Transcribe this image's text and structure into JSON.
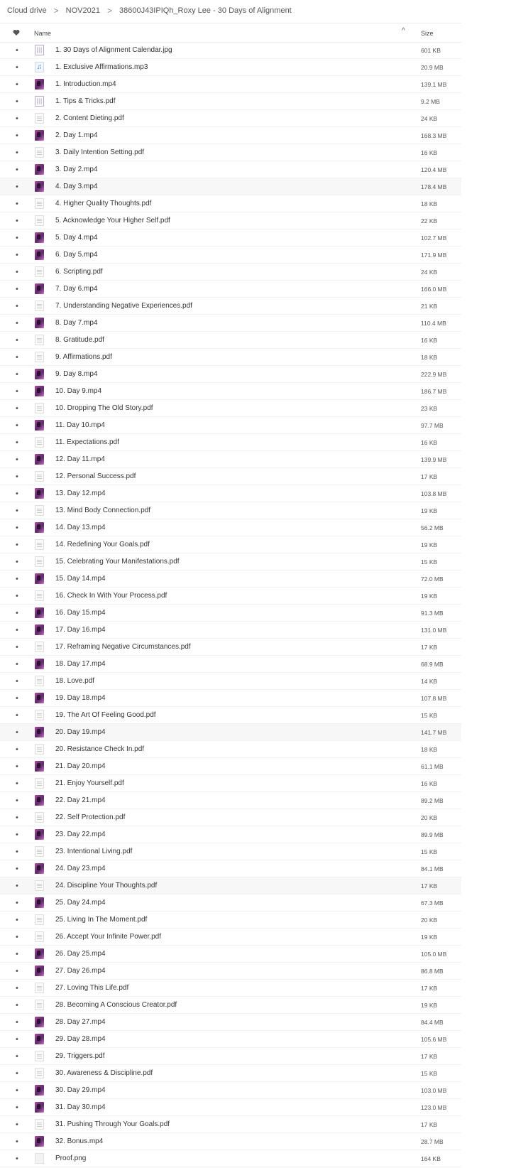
{
  "breadcrumb": [
    "Cloud drive",
    "NOV2021",
    "38600J43IPIQh_Roxy Lee - 30 Days of Alignment"
  ],
  "breadcrumb_separator": ">",
  "header": {
    "name": "Name",
    "size": "Size",
    "sort_indicator": "^"
  },
  "icons": {
    "heart": "heart-icon",
    "sort": "chevron-up-icon",
    "audio_glyph": "♫"
  },
  "files": [
    {
      "name": "1. 30 Days of Alignment Calendar.jpg",
      "size": "601 KB",
      "type": "image"
    },
    {
      "name": "1. Exclusive Affirmations.mp3",
      "size": "20.9 MB",
      "type": "audio"
    },
    {
      "name": "1. Introduction.mp4",
      "size": "139.1 MB",
      "type": "video"
    },
    {
      "name": "1. Tips & Tricks.pdf",
      "size": "9.2 MB",
      "type": "image"
    },
    {
      "name": "2. Content Dieting.pdf",
      "size": "24 KB",
      "type": "doc"
    },
    {
      "name": "2. Day 1.mp4",
      "size": "168.3 MB",
      "type": "video"
    },
    {
      "name": "3. Daily Intention Setting.pdf",
      "size": "16 KB",
      "type": "doc"
    },
    {
      "name": "3. Day 2.mp4",
      "size": "120.4 MB",
      "type": "video"
    },
    {
      "name": "4. Day 3.mp4",
      "size": "178.4 MB",
      "type": "video",
      "highlight": true
    },
    {
      "name": "4. Higher Quality Thoughts.pdf",
      "size": "18 KB",
      "type": "doc"
    },
    {
      "name": "5. Acknowledge Your Higher Self.pdf",
      "size": "22 KB",
      "type": "doc"
    },
    {
      "name": "5. Day 4.mp4",
      "size": "102.7 MB",
      "type": "video"
    },
    {
      "name": "6. Day 5.mp4",
      "size": "171.9 MB",
      "type": "video"
    },
    {
      "name": "6. Scripting.pdf",
      "size": "24 KB",
      "type": "doc"
    },
    {
      "name": "7. Day 6.mp4",
      "size": "166.0 MB",
      "type": "video"
    },
    {
      "name": "7. Understanding Negative Experiences.pdf",
      "size": "21 KB",
      "type": "doc"
    },
    {
      "name": "8. Day 7.mp4",
      "size": "110.4 MB",
      "type": "video"
    },
    {
      "name": "8. Gratitude.pdf",
      "size": "16 KB",
      "type": "doc"
    },
    {
      "name": "9. Affirmations.pdf",
      "size": "18 KB",
      "type": "doc"
    },
    {
      "name": "9. Day 8.mp4",
      "size": "222.9 MB",
      "type": "video"
    },
    {
      "name": "10. Day 9.mp4",
      "size": "186.7 MB",
      "type": "video"
    },
    {
      "name": "10. Dropping The Old Story.pdf",
      "size": "23 KB",
      "type": "doc"
    },
    {
      "name": "11. Day 10.mp4",
      "size": "97.7 MB",
      "type": "video"
    },
    {
      "name": "11. Expectations.pdf",
      "size": "16 KB",
      "type": "doc"
    },
    {
      "name": "12. Day 11.mp4",
      "size": "139.9 MB",
      "type": "video"
    },
    {
      "name": "12. Personal Success.pdf",
      "size": "17 KB",
      "type": "doc"
    },
    {
      "name": "13. Day 12.mp4",
      "size": "103.8 MB",
      "type": "video"
    },
    {
      "name": "13. Mind Body Connection.pdf",
      "size": "19 KB",
      "type": "doc"
    },
    {
      "name": "14. Day 13.mp4",
      "size": "56.2 MB",
      "type": "video"
    },
    {
      "name": "14. Redefining Your Goals.pdf",
      "size": "19 KB",
      "type": "doc"
    },
    {
      "name": "15. Celebrating Your Manifestations.pdf",
      "size": "15 KB",
      "type": "doc"
    },
    {
      "name": "15. Day 14.mp4",
      "size": "72.0 MB",
      "type": "video"
    },
    {
      "name": "16. Check In With Your Process.pdf",
      "size": "19 KB",
      "type": "doc"
    },
    {
      "name": "16. Day 15.mp4",
      "size": "91.3 MB",
      "type": "video"
    },
    {
      "name": "17. Day 16.mp4",
      "size": "131.0 MB",
      "type": "video"
    },
    {
      "name": "17. Reframing Negative Circumstances.pdf",
      "size": "17 KB",
      "type": "doc"
    },
    {
      "name": "18. Day 17.mp4",
      "size": "68.9 MB",
      "type": "video"
    },
    {
      "name": "18. Love.pdf",
      "size": "14 KB",
      "type": "doc"
    },
    {
      "name": "19. Day 18.mp4",
      "size": "107.8 MB",
      "type": "video"
    },
    {
      "name": "19. The Art Of Feeling Good.pdf",
      "size": "15 KB",
      "type": "doc"
    },
    {
      "name": "20. Day 19.mp4",
      "size": "141.7 MB",
      "type": "video",
      "highlight": true
    },
    {
      "name": "20. Resistance Check In.pdf",
      "size": "18 KB",
      "type": "doc"
    },
    {
      "name": "21. Day 20.mp4",
      "size": "61.1 MB",
      "type": "video"
    },
    {
      "name": "21. Enjoy Yourself.pdf",
      "size": "16 KB",
      "type": "doc"
    },
    {
      "name": "22. Day 21.mp4",
      "size": "89.2 MB",
      "type": "video"
    },
    {
      "name": "22. Self Protection.pdf",
      "size": "20 KB",
      "type": "doc"
    },
    {
      "name": "23. Day 22.mp4",
      "size": "89.9 MB",
      "type": "video"
    },
    {
      "name": "23. Intentional Living.pdf",
      "size": "15 KB",
      "type": "doc"
    },
    {
      "name": "24. Day 23.mp4",
      "size": "84.1 MB",
      "type": "video"
    },
    {
      "name": "24. Discipline Your Thoughts.pdf",
      "size": "17 KB",
      "type": "doc",
      "highlight": true
    },
    {
      "name": "25. Day 24.mp4",
      "size": "67.3 MB",
      "type": "video"
    },
    {
      "name": "25. Living In The Moment.pdf",
      "size": "20 KB",
      "type": "doc"
    },
    {
      "name": "26. Accept Your Infinite Power.pdf",
      "size": "19 KB",
      "type": "doc"
    },
    {
      "name": "26. Day 25.mp4",
      "size": "105.0 MB",
      "type": "video"
    },
    {
      "name": "27. Day 26.mp4",
      "size": "86.8 MB",
      "type": "video"
    },
    {
      "name": "27. Loving This Life.pdf",
      "size": "17 KB",
      "type": "doc"
    },
    {
      "name": "28. Becoming A Conscious Creator.pdf",
      "size": "19 KB",
      "type": "doc"
    },
    {
      "name": "28. Day 27.mp4",
      "size": "84.4 MB",
      "type": "video"
    },
    {
      "name": "29. Day 28.mp4",
      "size": "105.6 MB",
      "type": "video"
    },
    {
      "name": "29. Triggers.pdf",
      "size": "17 KB",
      "type": "doc"
    },
    {
      "name": "30. Awareness & Discipline.pdf",
      "size": "15 KB",
      "type": "doc"
    },
    {
      "name": "30. Day 29.mp4",
      "size": "103.0 MB",
      "type": "video"
    },
    {
      "name": "31. Day 30.mp4",
      "size": "123.0 MB",
      "type": "video"
    },
    {
      "name": "31. Pushing Through Your Goals.pdf",
      "size": "17 KB",
      "type": "doc"
    },
    {
      "name": "32. Bonus.mp4",
      "size": "28.7 MB",
      "type": "video"
    },
    {
      "name": "Proof.png",
      "size": "164 KB",
      "type": "blank"
    }
  ]
}
